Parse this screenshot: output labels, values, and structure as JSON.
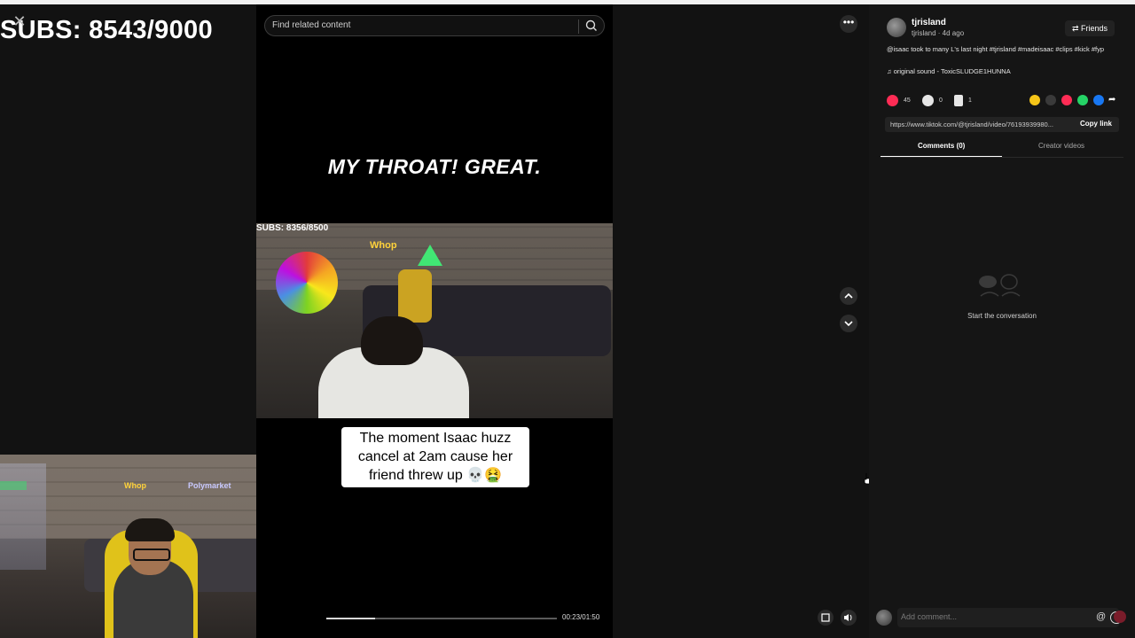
{
  "overlay": {
    "subs_text": "SUBS: 8543/9000",
    "close_glyph": "✕"
  },
  "search": {
    "placeholder": "Find related content",
    "icon": "search-icon"
  },
  "video": {
    "top_caption": "MY THROAT! GREAT.",
    "stream_subs": "SUBS: 8356/8500",
    "stream_brand": "Whop",
    "mid_caption": "The moment Isaac huzz cancel at 2am cause her friend threw up 💀🤮",
    "timecode": "00:23/01:50",
    "progress_fraction": 0.21
  },
  "webcam": {
    "brand1": "Whop",
    "brand2": "Polymarket"
  },
  "post": {
    "username": "tjrisland",
    "meta": "tjrisland · 4d ago",
    "friends_label": "Friends",
    "description": "@isaac took to many L's last night #tjrisland #madeisaac #clips #kick #fyp",
    "sound": "original sound - ToxicSLUDGE1HUNNA",
    "likes": "45",
    "comments": "0",
    "saves": "1",
    "link": "https://www.tiktok.com/@tjrisland/video/76193939980...",
    "copy_label": "Copy link"
  },
  "tabs": {
    "comments": "Comments (0)",
    "creator": "Creator videos"
  },
  "empty_state": {
    "text": "Start the conversation"
  },
  "comment_input": {
    "placeholder": "Add comment...",
    "mention": "@"
  },
  "colors": {
    "like": "#fe2c55",
    "accent_green": "#3cff7a"
  }
}
